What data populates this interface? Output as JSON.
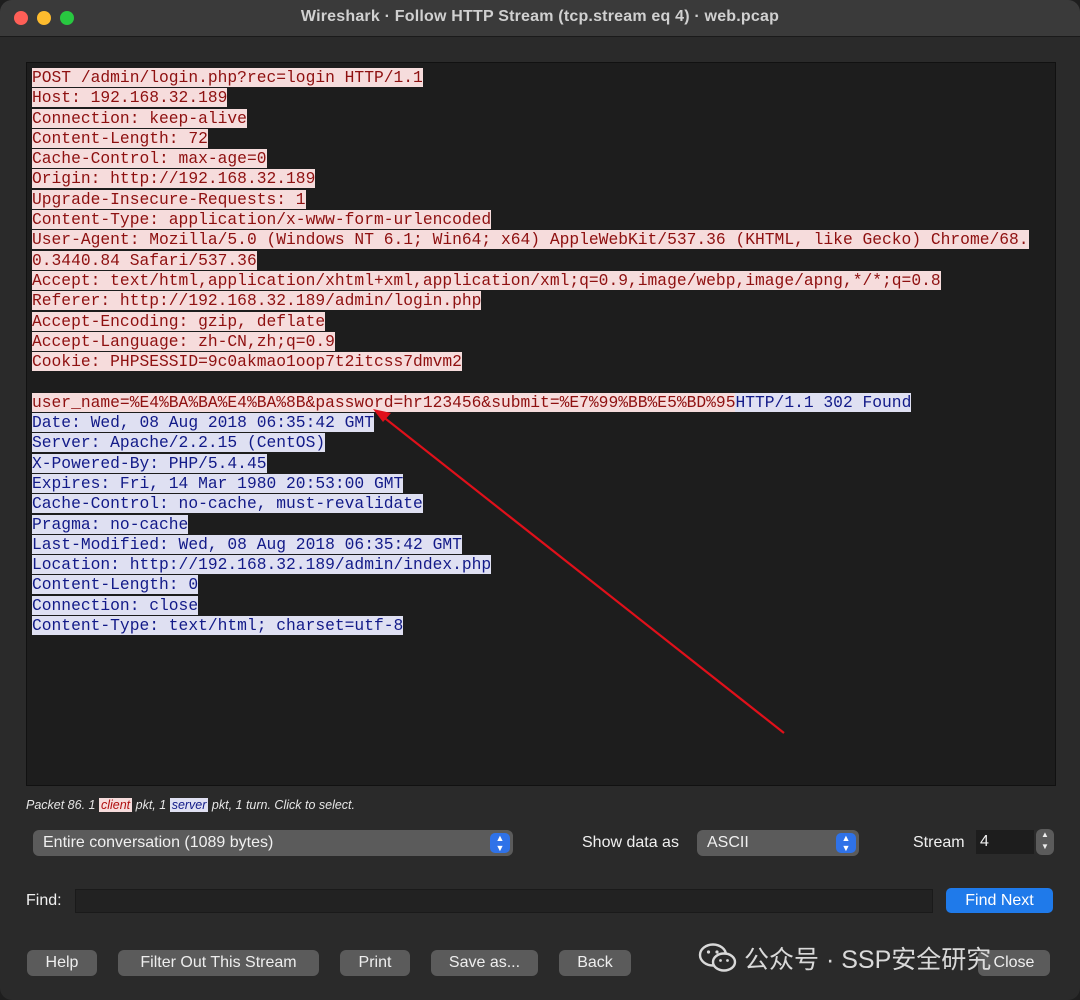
{
  "window": {
    "title": "Wireshark · Follow HTTP Stream (tcp.stream eq 4) · web.pcap"
  },
  "stream": {
    "client_lines": [
      "POST /admin/login.php?rec=login HTTP/1.1",
      "Host: 192.168.32.189",
      "Connection: keep-alive",
      "Content-Length: 72",
      "Cache-Control: max-age=0",
      "Origin: http://192.168.32.189",
      "Upgrade-Insecure-Requests: 1",
      "Content-Type: application/x-www-form-urlencoded",
      "User-Agent: Mozilla/5.0 (Windows NT 6.1; Win64; x64) AppleWebKit/537.36 (KHTML, like Gecko) Chrome/68.",
      "0.3440.84 Safari/537.36",
      "Accept: text/html,application/xhtml+xml,application/xml;q=0.9,image/webp,image/apng,*/*;q=0.8",
      "Referer: http://192.168.32.189/admin/login.php",
      "Accept-Encoding: gzip, deflate",
      "Accept-Language: zh-CN,zh;q=0.9",
      "Cookie: PHPSESSID=9c0akmao1oop7t2itcss7dmvm2"
    ],
    "body_client": "user_name=%E4%BA%BA%E4%BA%8B&password=hr123456&submit=%E7%99%BB%E5%BD%95",
    "body_server": "HTTP/1.1 302 Found",
    "server_lines": [
      "Date: Wed, 08 Aug 2018 06:35:42 GMT",
      "Server: Apache/2.2.15 (CentOS)",
      "X-Powered-By: PHP/5.4.45",
      "Expires: Fri, 14 Mar 1980 20:53:00 GMT",
      "Cache-Control: no-cache, must-revalidate",
      "Pragma: no-cache",
      "Last-Modified: Wed, 08 Aug 2018 06:35:42 GMT",
      "Location: http://192.168.32.189/admin/index.php",
      "Content-Length: 0",
      "Connection: close",
      "Content-Type: text/html; charset=utf-8"
    ]
  },
  "status": {
    "prefix": "Packet 86. 1 ",
    "client_tag": "client",
    "mid": " pkt, 1 ",
    "server_tag": "server",
    "suffix": " pkt, 1 turn. Click to select."
  },
  "controls": {
    "conversation": "Entire conversation (1089 bytes)",
    "show_data_as_label": "Show data as",
    "show_data_as": "ASCII",
    "stream_label": "Stream",
    "stream_value": "4",
    "find_label": "Find:",
    "find_value": "",
    "find_next": "Find Next"
  },
  "buttons": {
    "help": "Help",
    "filter_out": "Filter Out This Stream",
    "print": "Print",
    "save_as": "Save as...",
    "back": "Back",
    "close": "Close"
  },
  "watermark": "公众号 · SSP安全研究",
  "colors": {
    "client_bg": "#f6dcdc",
    "client_fg": "#8e1010",
    "server_bg": "#dfe0f2",
    "server_fg": "#121a88",
    "annotation_arrow": "#e0101a",
    "accent_blue": "#1f7aea"
  },
  "icons": {
    "wechat": "wechat-icon",
    "select_chevron": "chevron-updown-icon",
    "stepper": "stepper-icon"
  }
}
